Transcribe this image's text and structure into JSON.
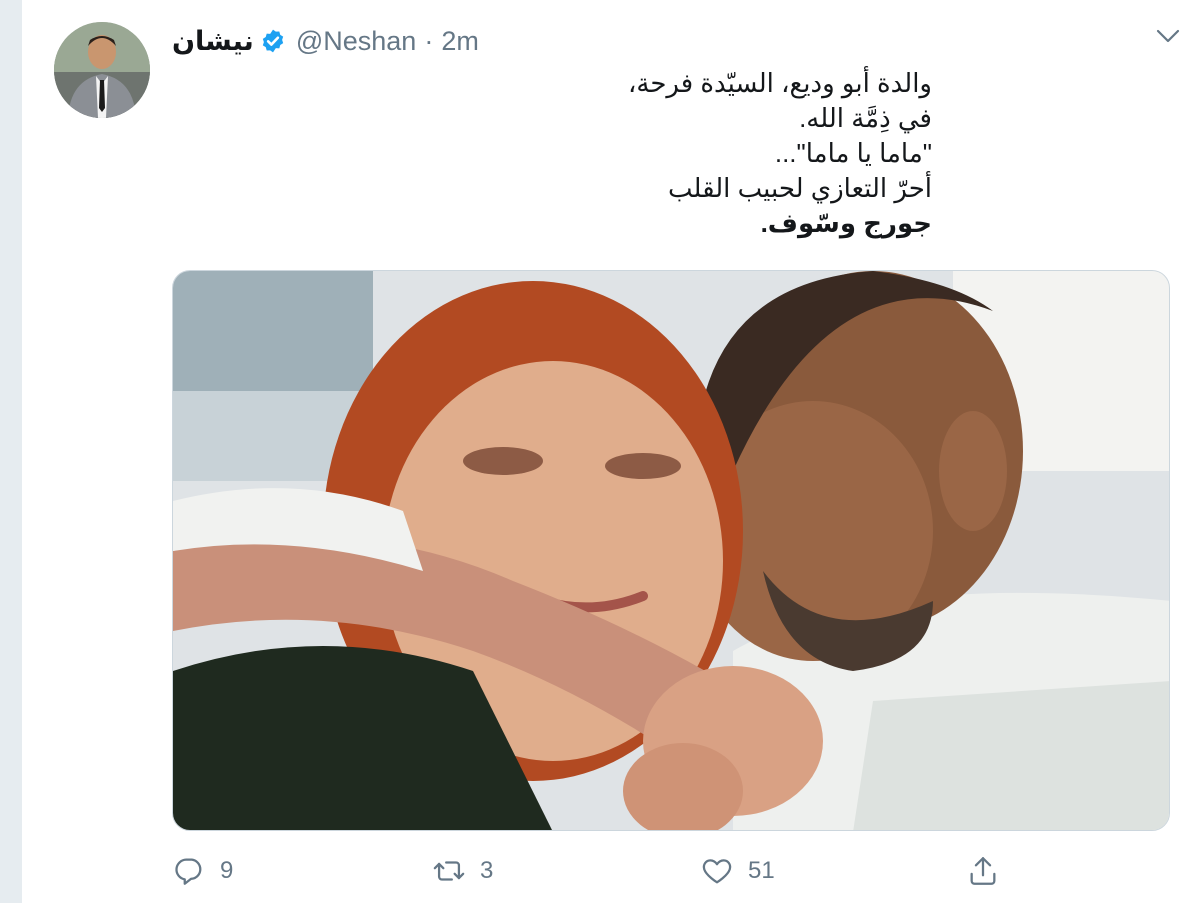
{
  "tweet": {
    "display_name": "نيشان",
    "handle": "@Neshan",
    "separator": "·",
    "time_ago": "2m",
    "text_lines": [
      "والدة أبو وديع، السيّدة فرحة،",
      "في ذِمَّة الله.",
      "\"ماما يا ماما\"...",
      "أحرّ التعازي لحبيب القلب",
      "جورج وسّوف."
    ],
    "verified_color": "#1da1f2"
  },
  "actions": {
    "reply_count": "9",
    "retweet_count": "3",
    "like_count": "51",
    "reply_icon": "reply-icon",
    "retweet_icon": "retweet-icon",
    "like_icon": "like-icon",
    "share_icon": "share-icon"
  },
  "colors": {
    "text_primary": "#14171a",
    "text_secondary": "#657786",
    "background": "#e6ecf0",
    "card": "#ffffff"
  }
}
